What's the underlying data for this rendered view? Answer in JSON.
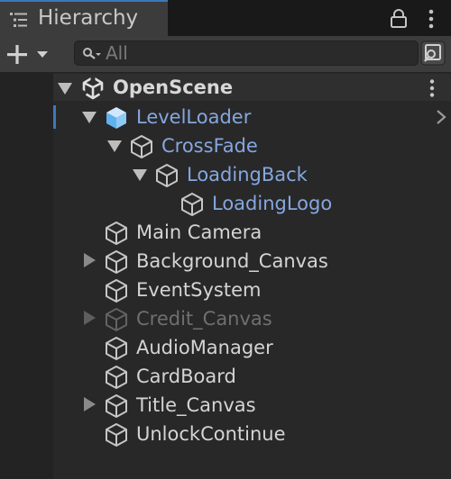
{
  "window": {
    "tab_title": "Hierarchy",
    "tab_icon": "hierarchy-list-icon",
    "lock_icon": "lock-icon",
    "menu_icon": "kebab-menu-icon"
  },
  "toolbar": {
    "add_icon": "plus-icon",
    "dropdown_icon": "chevron-down-icon",
    "search_placeholder": "All",
    "search_value": "",
    "search_icon": "search-icon",
    "scene_search_icon": "scene-search-icon"
  },
  "scene": {
    "name": "OpenScene",
    "icon": "unity-logo-icon",
    "menu_icon": "kebab-menu-icon"
  },
  "tree": [
    {
      "label": "LevelLoader",
      "state": "expanded",
      "style": "selected"
    },
    {
      "label": "CrossFade",
      "state": "expanded",
      "style": "prefab"
    },
    {
      "label": "LoadingBack",
      "state": "expanded",
      "style": "prefab"
    },
    {
      "label": "LoadingLogo",
      "state": "leaf",
      "style": "prefab"
    },
    {
      "label": "Main Camera",
      "state": "leaf",
      "style": "normal"
    },
    {
      "label": "Background_Canvas",
      "state": "collapsed",
      "style": "normal"
    },
    {
      "label": "EventSystem",
      "state": "leaf",
      "style": "normal"
    },
    {
      "label": "Credit_Canvas",
      "state": "collapsed",
      "style": "inactive"
    },
    {
      "label": "AudioManager",
      "state": "leaf",
      "style": "normal"
    },
    {
      "label": "CardBoard",
      "state": "leaf",
      "style": "normal"
    },
    {
      "label": "Title_Canvas",
      "state": "collapsed",
      "style": "normal"
    },
    {
      "label": "UnlockContinue",
      "state": "leaf",
      "style": "normal"
    }
  ],
  "colors": {
    "accent": "#3a79bb",
    "prefab_text": "#85a7e0",
    "inactive_text": "#6f6f6f",
    "normal_text": "#d4d4d4"
  }
}
